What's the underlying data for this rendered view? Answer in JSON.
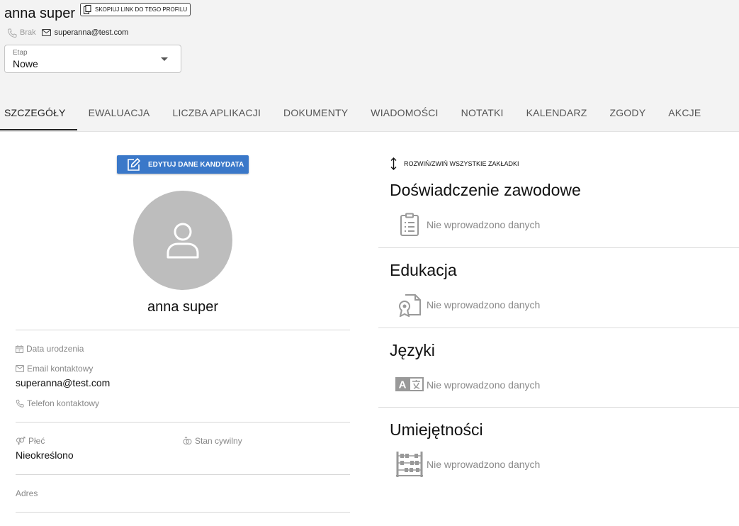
{
  "header": {
    "name": "anna super",
    "copy_link_label": "SKOPIUJ LINK DO TEGO PROFILU",
    "phone": "Brak",
    "email": "superanna@test.com"
  },
  "stage": {
    "label": "Etap",
    "value": "Nowe"
  },
  "tabs": [
    {
      "label": "SZCZEGÓŁY",
      "active": true
    },
    {
      "label": "EWALUACJA",
      "active": false
    },
    {
      "label": "LICZBA APLIKACJI",
      "active": false
    },
    {
      "label": "DOKUMENTY",
      "active": false
    },
    {
      "label": "WIADOMOŚCI",
      "active": false
    },
    {
      "label": "NOTATKI",
      "active": false
    },
    {
      "label": "KALENDARZ",
      "active": false
    },
    {
      "label": "ZGODY",
      "active": false
    },
    {
      "label": "AKCJE",
      "active": false
    }
  ],
  "profile": {
    "edit_button": "EDYTUJ DANE KANDYDATA",
    "name": "anna super",
    "birth_date_label": "Data urodzenia",
    "contact_email_label": "Email kontaktowy",
    "contact_email_value": "superanna@test.com",
    "contact_phone_label": "Telefon kontaktowy",
    "gender_label": "Płeć",
    "gender_value": "Nieokreślono",
    "marital_label": "Stan cywilny",
    "address_label": "Adres"
  },
  "right": {
    "expand_all": "ROZWIŃ/ZWIŃ WSZYSTKIE ZAKŁADKI",
    "sections": [
      {
        "title": "Doświadczenie zawodowe",
        "empty": "Nie wprowadzono danych",
        "icon": "clipboard-list-icon"
      },
      {
        "title": "Edukacja",
        "empty": "Nie wprowadzono danych",
        "icon": "certificate-icon"
      },
      {
        "title": "Języki",
        "empty": "Nie wprowadzono danych",
        "icon": "language-icon"
      },
      {
        "title": "Umiejętności",
        "empty": "Nie wprowadzono danych",
        "icon": "abacus-icon"
      }
    ]
  },
  "colors": {
    "accent": "#3a78c9",
    "header_bg": "#f3f3f3",
    "avatar_bg": "#bdbdbd"
  }
}
